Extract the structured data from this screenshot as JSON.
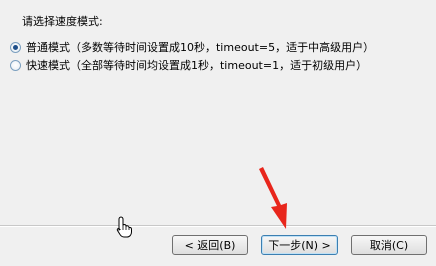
{
  "prompt": "请选择速度模式:",
  "options": [
    {
      "label": "普通模式（多数等待时间设置成10秒，timeout=5，适于中高级用户）",
      "selected": true
    },
    {
      "label": "快速模式（全部等待时间均设置成1秒，timeout=1，适于初级用户）",
      "selected": false
    }
  ],
  "buttons": {
    "back": "< 返回(B)",
    "next": "下一步(N) >",
    "cancel": "取消(C)"
  },
  "colors": {
    "annotation_arrow": "#e8261c",
    "focus_border": "#3c7fb1"
  }
}
